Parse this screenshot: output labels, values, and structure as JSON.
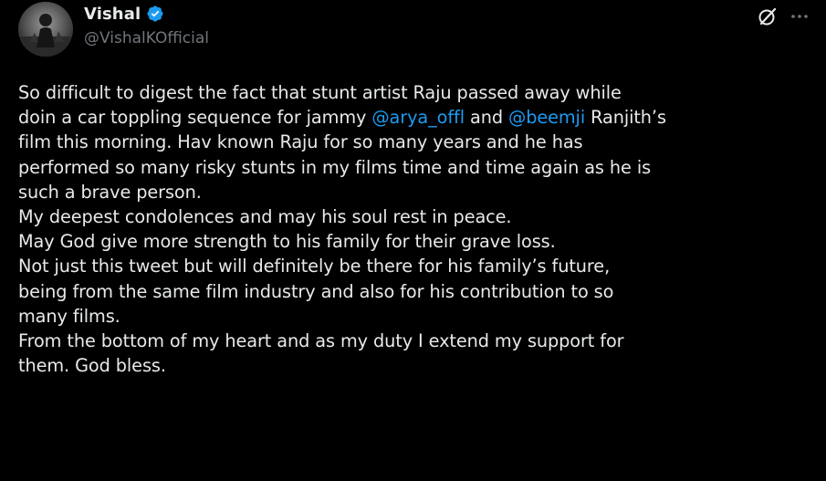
{
  "author": {
    "display_name": "Vishal",
    "handle": "@VishalKOfficial",
    "verified_icon": "verified-badge-icon",
    "verified_color": "#1d9bf0"
  },
  "actions": {
    "grok_icon": "grok-slash-icon",
    "more_icon": "more-dots-icon"
  },
  "colors": {
    "background": "#000000",
    "text": "#e7e9ea",
    "secondary": "#71767b",
    "link": "#1d9bf0"
  },
  "tweet": {
    "lines": [
      {
        "segments": [
          {
            "text": "So difficult to digest the fact that stunt artist Raju passed away while"
          }
        ]
      },
      {
        "segments": [
          {
            "text": "doin a car toppling sequence for jammy "
          },
          {
            "text": "@arya_offl",
            "mention": true
          },
          {
            "text": " and "
          },
          {
            "text": "@beemji",
            "mention": true
          },
          {
            "text": " Ranjith’s"
          }
        ]
      },
      {
        "segments": [
          {
            "text": "film this morning. Hav known Raju for so many years and he has"
          }
        ]
      },
      {
        "segments": [
          {
            "text": "performed so many risky stunts in my films time and time again as he is"
          }
        ]
      },
      {
        "segments": [
          {
            "text": "such a brave person."
          }
        ]
      },
      {
        "segments": [
          {
            "text": "My deepest condolences and may his soul rest in peace."
          }
        ]
      },
      {
        "segments": [
          {
            "text": "May God give more strength to his family for their grave loss."
          }
        ]
      },
      {
        "segments": [
          {
            "text": "Not just this tweet but will definitely be there for his family’s future,"
          }
        ]
      },
      {
        "segments": [
          {
            "text": "being from the same film industry and also for his contribution to so"
          }
        ]
      },
      {
        "segments": [
          {
            "text": "many films."
          }
        ]
      },
      {
        "segments": [
          {
            "text": "From the bottom of my heart and as my duty I extend my support for"
          }
        ]
      },
      {
        "segments": [
          {
            "text": "them.  God bless."
          }
        ]
      }
    ]
  }
}
